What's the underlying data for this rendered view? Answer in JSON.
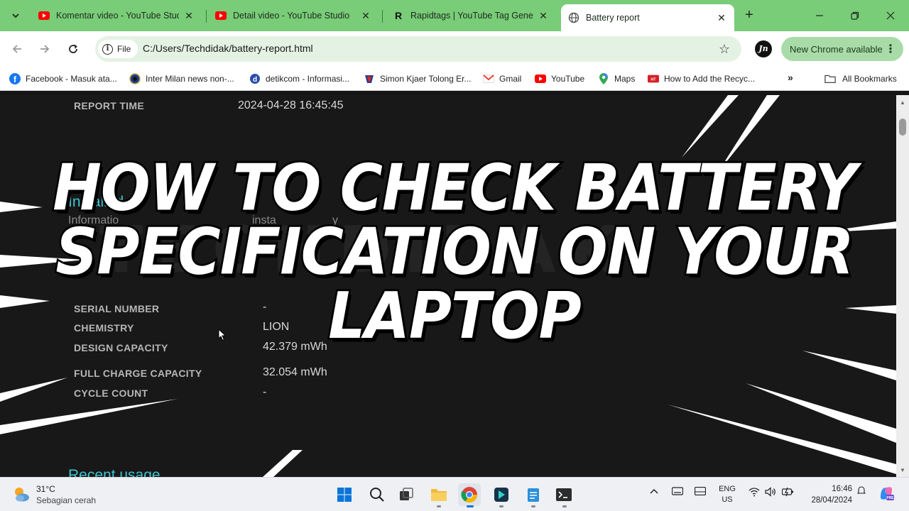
{
  "tabs": [
    {
      "title": "Komentar video - YouTube Studio",
      "icon": "youtube-icon"
    },
    {
      "title": "Detail video - YouTube Studio",
      "icon": "youtube-icon"
    },
    {
      "title": "Rapidtags | YouTube Tag Generator",
      "icon": "rapidtags-icon"
    },
    {
      "title": "Battery report",
      "icon": "globe-icon",
      "active": true
    }
  ],
  "toolbar": {
    "chip_label": "File",
    "url": "C:/Users/Techdidak/battery-report.html",
    "update_label": "New Chrome available",
    "profile_initials": "Jn"
  },
  "bookmarks": [
    {
      "label": "Facebook - Masuk ata...",
      "icon": "facebook-icon"
    },
    {
      "label": "Inter Milan news non-...",
      "icon": "inter-icon"
    },
    {
      "label": "detikcom - Informasi...",
      "icon": "detik-icon"
    },
    {
      "label": "Simon Kjaer Tolong Er...",
      "icon": "milan-icon"
    },
    {
      "label": "Gmail",
      "icon": "gmail-icon"
    },
    {
      "label": "YouTube",
      "icon": "youtube-icon"
    },
    {
      "label": "Maps",
      "icon": "maps-icon"
    },
    {
      "label": "How to Add the Recyc...",
      "icon": "hp-icon"
    }
  ],
  "all_bookmarks_label": "All Bookmarks",
  "report": {
    "report_time_label": "REPORT TIME",
    "report_time_value": "2024-04-28  16:45:45",
    "installed_heading": "Installed",
    "installed_heading_tail": "ie",
    "installed_sub_start": "Informatio",
    "installed_sub_mid": "insta",
    "installed_sub_end": "y",
    "serial_label": "SERIAL NUMBER",
    "serial_value": "-",
    "rows": [
      {
        "label": "CHEMISTRY",
        "value": "LION"
      },
      {
        "label": "DESIGN CAPACITY",
        "value": "42.379 mWh"
      },
      {
        "label": "FULL CHARGE CAPACITY",
        "value": "32.054 mWh"
      },
      {
        "label": "CYCLE COUNT",
        "value": "-"
      }
    ],
    "recent_heading": "Recent usage"
  },
  "overlay": {
    "line1": "HOW TO CHECK BATTERY",
    "line2": "SPECIFICATION ON YOUR LAPTOP",
    "watermark": "TECHDIDAK"
  },
  "taskbar": {
    "temperature": "31°C",
    "condition": "Sebagian cerah",
    "lang_line1": "ENG",
    "lang_line2": "US",
    "time": "16:46",
    "date": "28/04/2024"
  },
  "colors": {
    "tab_strip": "#79cc78",
    "heading_cyan": "#3cc3cf",
    "page_bg": "#181818"
  }
}
